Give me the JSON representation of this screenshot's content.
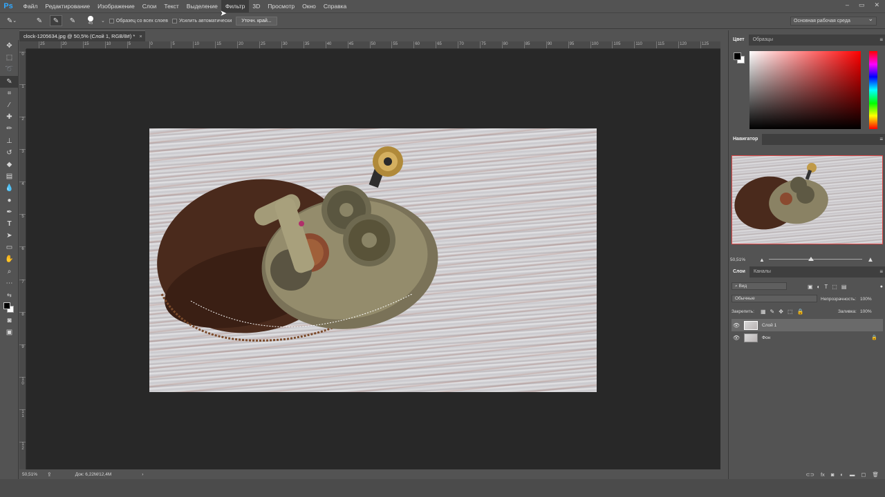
{
  "app": {
    "logo": "Ps"
  },
  "menu": [
    "Файл",
    "Редактирование",
    "Изображение",
    "Слои",
    "Текст",
    "Выделение",
    "Фильтр",
    "3D",
    "Просмотр",
    "Окно",
    "Справка"
  ],
  "window_controls": [
    "–",
    "▭",
    "✕"
  ],
  "options": {
    "brush_size": "45",
    "sample_all_layers": "Образец со всех слоев",
    "auto_enhance": "Усилить автоматически",
    "refine_edge": "Уточн. край...",
    "workspace": "Основная рабочая среда"
  },
  "document": {
    "tab": "clock-1205634.jpg @ 50,5% (Слой 1, RGB/8#) *",
    "close": "×"
  },
  "ruler_h": [
    "25",
    "20",
    "15",
    "10",
    "5",
    "0",
    "5",
    "10",
    "15",
    "20",
    "25",
    "30",
    "35",
    "40",
    "45",
    "50",
    "55",
    "60",
    "65",
    "70",
    "75",
    "80",
    "85",
    "90",
    "95",
    "100",
    "105",
    "110",
    "115",
    "120",
    "125"
  ],
  "ruler_v": [
    "0",
    "1",
    "2",
    "3",
    "4",
    "5",
    "6",
    "7",
    "8",
    "9",
    "1\n0",
    "1\n1",
    "1\n2"
  ],
  "status": {
    "zoom": "50,51%",
    "doc": "Док: 6,22M/12,4M",
    "arrow": "›"
  },
  "color_panel": {
    "tabs": [
      "Цвет",
      "Образцы"
    ],
    "fg": "#000000",
    "bg": "#ffffff"
  },
  "navigator": {
    "title": "Навигатор",
    "zoom": "50,51%"
  },
  "layers_panel": {
    "tabs": [
      "Слои",
      "Каналы"
    ],
    "filter": "Вид",
    "blend": "Обычные",
    "opacity_label": "Непрозрачность:",
    "opacity": "100%",
    "lock_label": "Закрепить:",
    "fill_label": "Заливка:",
    "fill": "100%",
    "layers": [
      {
        "name": "Слой 1",
        "active": true,
        "locked": false
      },
      {
        "name": "Фон",
        "active": false,
        "locked": true
      }
    ]
  },
  "accent": "#31a8ff"
}
